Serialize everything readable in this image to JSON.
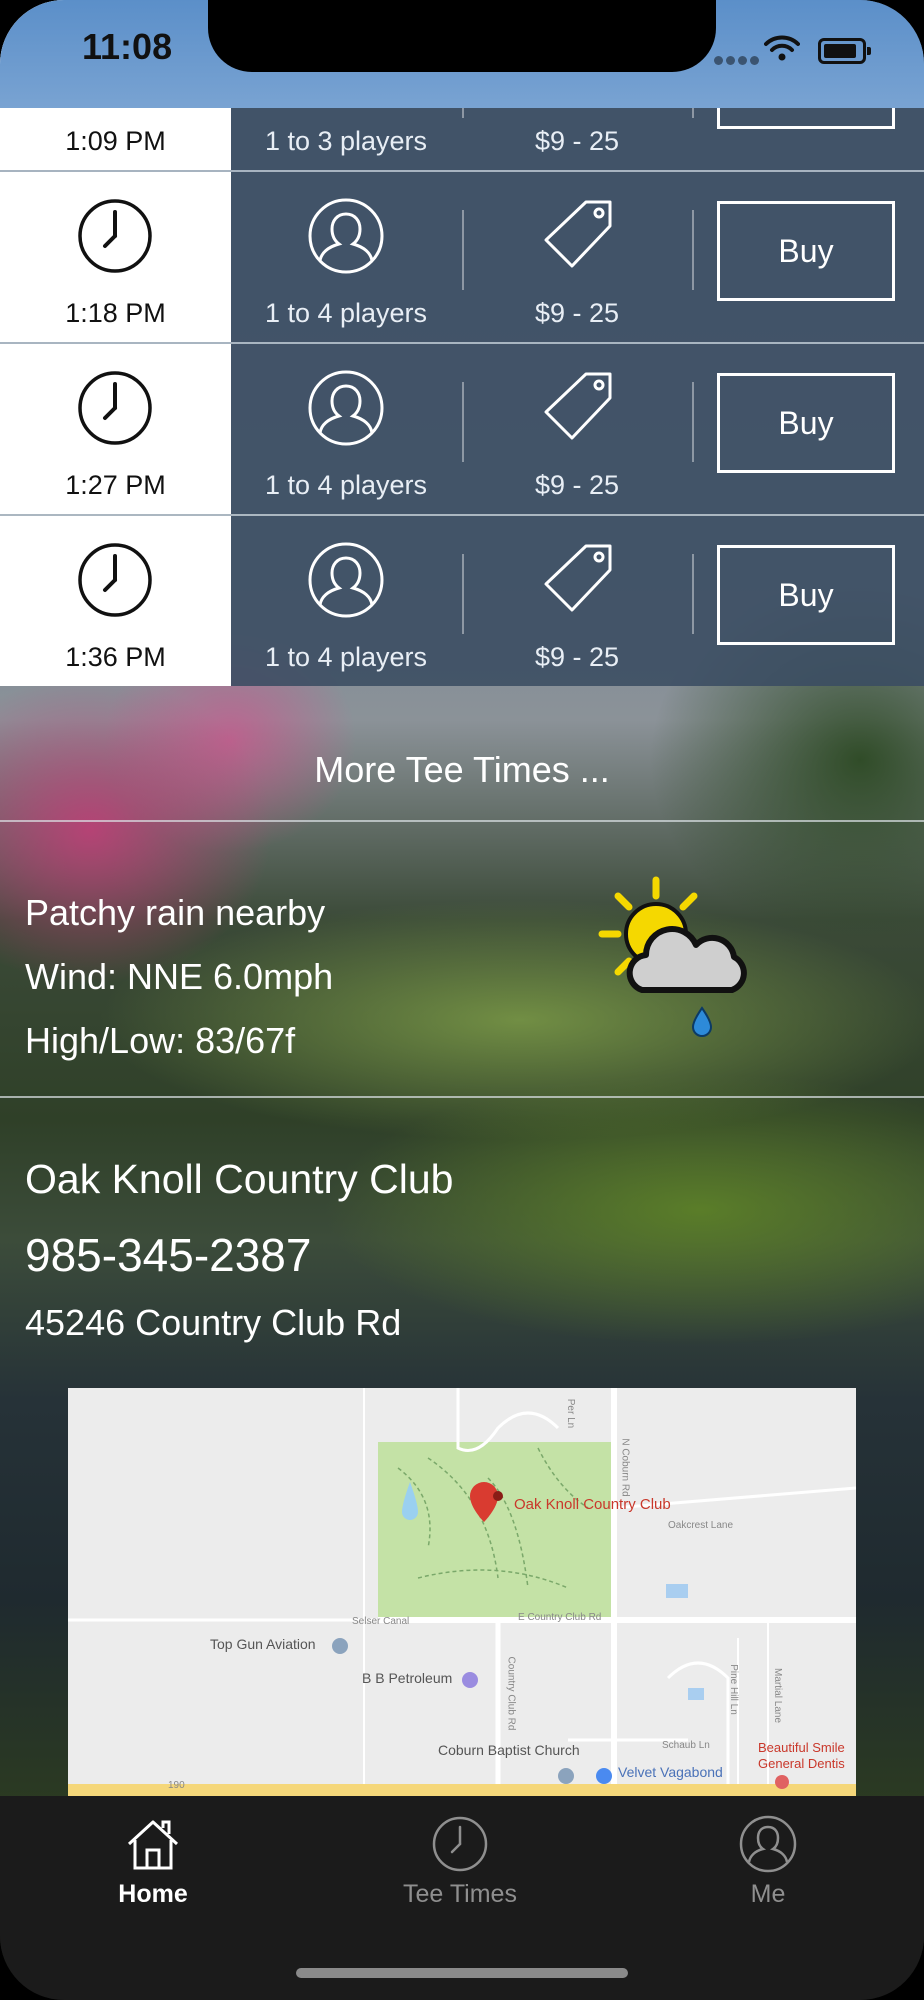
{
  "status_bar": {
    "time": "11:08"
  },
  "tee_times": [
    {
      "time": "1:09 PM",
      "players": "1 to 3 players",
      "price": "$9 - 25",
      "action": "Buy"
    },
    {
      "time": "1:18 PM",
      "players": "1 to 4 players",
      "price": "$9 - 25",
      "action": "Buy"
    },
    {
      "time": "1:27 PM",
      "players": "1 to 4 players",
      "price": "$9 - 25",
      "action": "Buy"
    },
    {
      "time": "1:36 PM",
      "players": "1 to 4 players",
      "price": "$9 - 25",
      "action": "Buy"
    }
  ],
  "more_tee_times": "More Tee Times ...",
  "weather": {
    "condition": "Patchy rain nearby",
    "wind": "Wind: NNE 6.0mph",
    "high_low": "High/Low: 83/67f",
    "icon": "sun-cloud-rain-icon"
  },
  "club": {
    "name": "Oak Knoll Country Club",
    "phone": "985-345-2387",
    "address": "45246 Country Club Rd"
  },
  "map": {
    "pin_label": "Oak Knoll Country Club",
    "places": [
      "Top Gun Aviation",
      "B B Petroleum",
      "Coburn Baptist Church",
      "Velvet Vagabond",
      "Beautiful Smile",
      "General Dentis"
    ],
    "roads": [
      "Oakcrest Lane",
      "E Country Club Rd",
      "Selser Canal",
      "Country Club Rd",
      "N Coburn Rd",
      "Schaub Ln",
      "Martial Lane",
      "Per Ln",
      "Pine Hill Ln",
      "190"
    ]
  },
  "tabs": [
    {
      "label": "Home",
      "icon": "home-icon",
      "active": true
    },
    {
      "label": "Tee Times",
      "icon": "clock-icon",
      "active": false
    },
    {
      "label": "Me",
      "icon": "person-icon",
      "active": false
    }
  ],
  "colors": {
    "row_overlay": "#3a4c62",
    "time_cell": "#ffffff",
    "tabbar": "#1b1b1b",
    "status_bar": "#5b8fc9"
  }
}
